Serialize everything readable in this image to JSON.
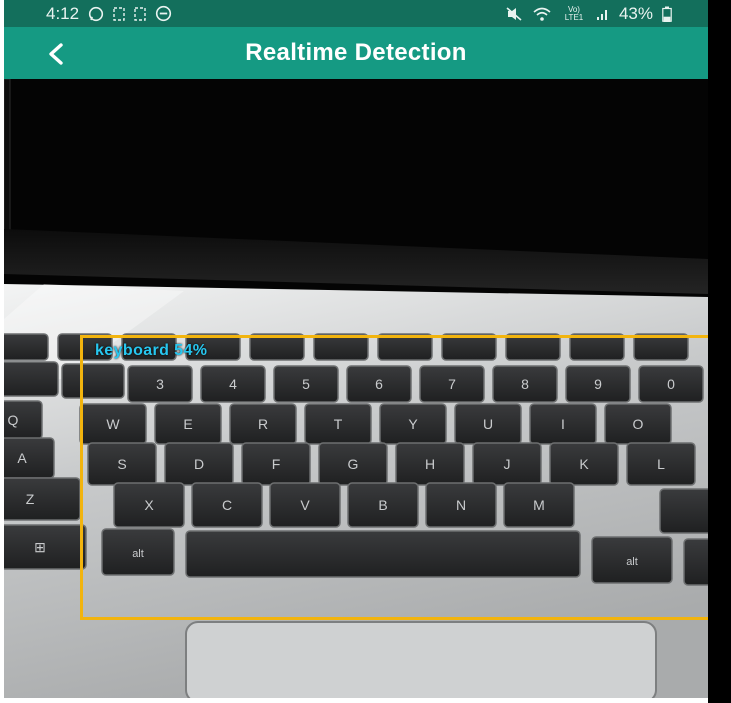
{
  "status_bar": {
    "time": "4:12",
    "left_icons": [
      "whatsapp-icon",
      "notification-icon",
      "notification-icon",
      "do-not-disturb-icon"
    ],
    "right_icons": [
      "mute-icon",
      "wifi-icon",
      "volte-icon",
      "signal-icon"
    ],
    "network": "Vo) LTE1",
    "battery_percent": "43%",
    "battery_level": 0.43
  },
  "app_bar": {
    "title": "Realtime Detection",
    "back_icon": "back-arrow-icon"
  },
  "detection": {
    "label": "keyboard 54%",
    "class": "keyboard",
    "confidence": 0.54,
    "box_color": "#f2b40e",
    "label_color": "#27c7f0"
  },
  "colors": {
    "status_bar": "#136f5c",
    "app_bar": "#159a83"
  },
  "keyboard_keys": {
    "number_row": [
      "3",
      "4",
      "5",
      "6",
      "7",
      "8",
      "9",
      "0"
    ],
    "top_row": [
      "Q",
      "W",
      "E",
      "R",
      "T",
      "Y",
      "U",
      "I",
      "O"
    ],
    "home_row": [
      "A",
      "S",
      "D",
      "F",
      "G",
      "H",
      "J",
      "K",
      "L"
    ],
    "bottom_row": [
      "Z",
      "X",
      "C",
      "V",
      "B",
      "N",
      "M"
    ],
    "alt_left": "alt",
    "alt_right": "alt"
  }
}
